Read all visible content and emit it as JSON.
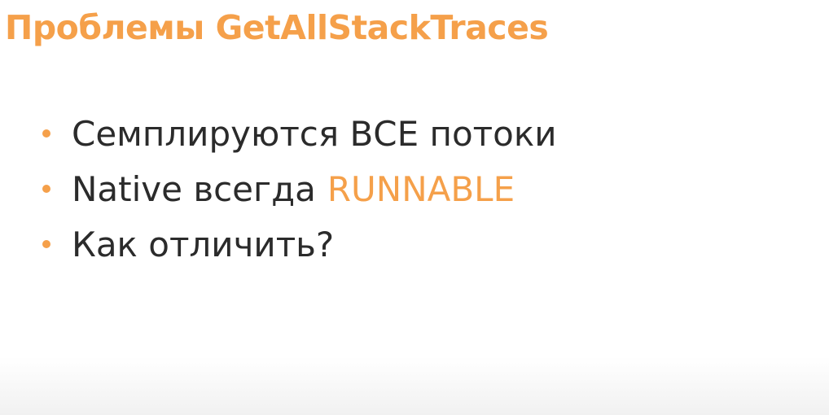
{
  "colors": {
    "accent": "#f5a04a",
    "text": "#2b2b2b"
  },
  "slide": {
    "title": "Проблемы GetAllStackTraces",
    "bullets": [
      {
        "text": "Семплируются ВСЕ потоки",
        "accent_text": ""
      },
      {
        "text": "Native всегда",
        "accent_text": "RUNNABLE"
      },
      {
        "text": "Как отличить?",
        "accent_text": ""
      }
    ]
  }
}
